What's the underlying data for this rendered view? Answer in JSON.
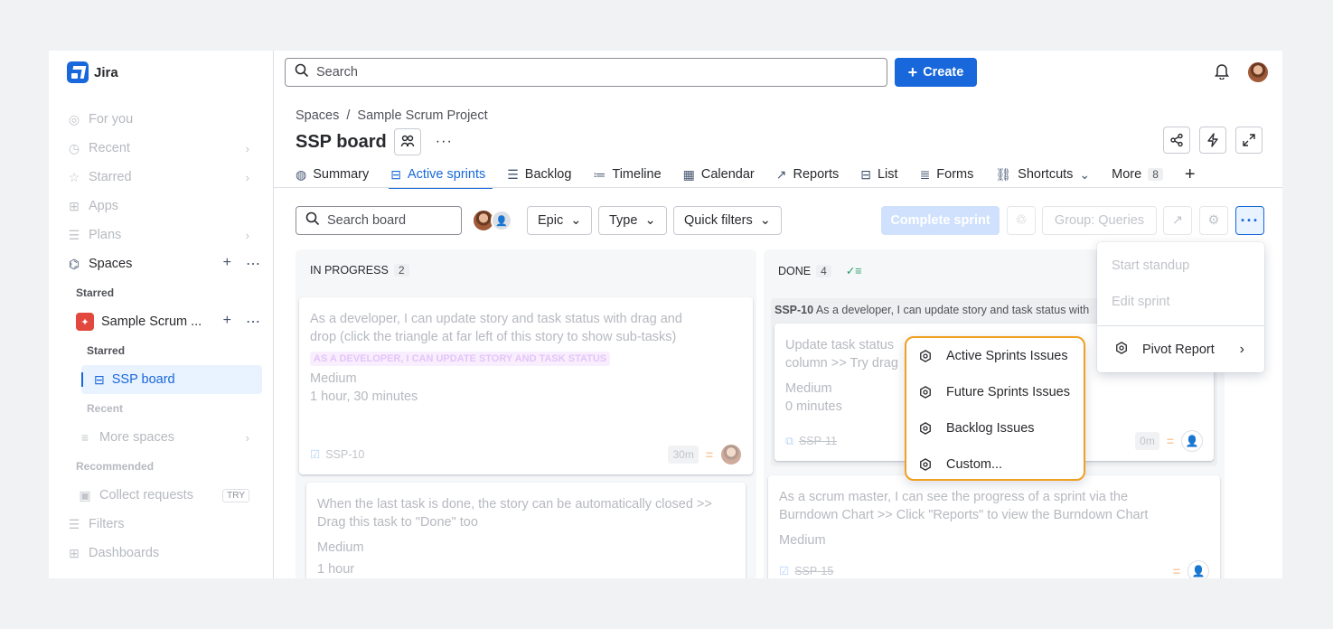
{
  "app": {
    "name": "Jira"
  },
  "sidebar": {
    "nav": [
      {
        "label": "For you"
      },
      {
        "label": "Recent"
      },
      {
        "label": "Starred"
      },
      {
        "label": "Apps"
      },
      {
        "label": "Plans"
      }
    ],
    "spaces_label": "Spaces",
    "starred_label": "Starred",
    "project_name": "Sample Scrum ...",
    "project_starred_label": "Starred",
    "board_label": "SSP board",
    "recent_label": "Recent",
    "more_spaces": "More spaces",
    "recommended_label": "Recommended",
    "collect_requests": "Collect requests",
    "try_badge": "TRY",
    "filters": "Filters",
    "dashboards": "Dashboards"
  },
  "topbar": {
    "search_placeholder": "Search",
    "create_label": "Create"
  },
  "breadcrumb": {
    "spaces": "Spaces",
    "sep": "/",
    "project": "Sample Scrum Project"
  },
  "page": {
    "title": "SSP board",
    "more": "···"
  },
  "tabs": [
    {
      "label": "Summary"
    },
    {
      "label": "Active sprints"
    },
    {
      "label": "Backlog"
    },
    {
      "label": "Timeline"
    },
    {
      "label": "Calendar"
    },
    {
      "label": "Reports"
    },
    {
      "label": "List"
    },
    {
      "label": "Forms"
    },
    {
      "label": "Shortcuts"
    },
    {
      "label": "More",
      "count": "8"
    }
  ],
  "toolbar": {
    "search_placeholder": "Search board",
    "epic": "Epic",
    "type": "Type",
    "quick_filters": "Quick filters",
    "complete_sprint": "Complete sprint",
    "group": "Group: Queries",
    "more": "···"
  },
  "columns": [
    {
      "name": "IN PROGRESS",
      "count": "2",
      "cards": [
        {
          "summary": "As a developer, I can update story and task status with drag and drop (click the triangle at far left of this story to show sub-tasks)",
          "epic": "AS A DEVELOPER, I CAN UPDATE STORY AND TASK STATUS",
          "priority": "Medium",
          "estimate": "1 hour, 30 minutes",
          "key": "SSP-10",
          "time": "30m"
        },
        {
          "summary": "When the last task is done, the story can be automatically closed >> Drag this task to \"Done\" too",
          "priority": "Medium",
          "estimate": "1 hour"
        }
      ]
    },
    {
      "name": "DONE",
      "count": "4",
      "parent": {
        "key": "SSP-10",
        "summary": "As a developer, I can update story and task status with"
      },
      "cards": [
        {
          "summary": "Update task status",
          "summary2": "column >> Try drag",
          "priority": "Medium",
          "estimate": "0 minutes",
          "key": "SSP-11",
          "time": "0m"
        },
        {
          "summary": "As a scrum master, I can see the progress of a sprint via the Burndown Chart >> Click \"Reports\" to view the Burndown Chart",
          "priority": "Medium",
          "key": "SSP-15"
        }
      ]
    }
  ],
  "more_menu": {
    "items": [
      {
        "label": "Start standup",
        "disabled": true
      },
      {
        "label": "Edit sprint",
        "disabled": true
      },
      {
        "label": "Pivot Report",
        "disabled": false
      }
    ]
  },
  "pivot_submenu": {
    "items": [
      {
        "label": "Active Sprints Issues"
      },
      {
        "label": "Future Sprints Issues"
      },
      {
        "label": "Backlog Issues"
      },
      {
        "label": "Custom..."
      }
    ],
    "highlight_color": "#f0a020"
  },
  "colors": {
    "brand": "#1868db",
    "project": "#e2483d"
  }
}
